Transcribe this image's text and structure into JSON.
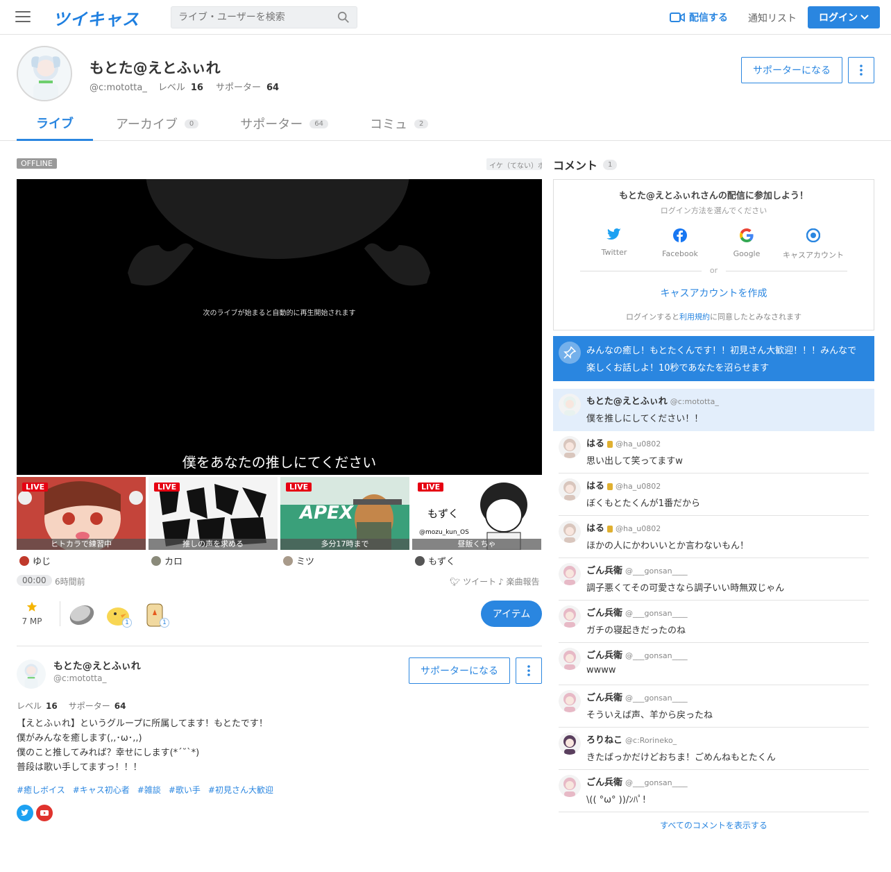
{
  "header": {
    "logo": "ツイキャス",
    "search_placeholder": "ライブ・ユーザーを検索",
    "broadcast": "配信する",
    "notify_list": "通知リスト",
    "login": "ログイン"
  },
  "profile": {
    "name": "もとた@えとふぃれ",
    "handle": "@c:mototta_",
    "level_label": "レベル",
    "level": "16",
    "supporter_label": "サポーター",
    "supporters": "64",
    "support_button": "サポーターになる"
  },
  "tabs": [
    {
      "label": "ライブ",
      "count": ""
    },
    {
      "label": "アーカイブ",
      "count": "0"
    },
    {
      "label": "サポーター",
      "count": "64"
    },
    {
      "label": "コミュ",
      "count": "2"
    }
  ],
  "live": {
    "status": "OFFLINE",
    "category": "イケ（てない）ボ",
    "autoplay_message": "次のライブが始まると自動的に再生開始されます",
    "title": "僕をあなたの推しにてください",
    "duration": "00:00",
    "time_ago": "6時間前",
    "tweet": "ツイート",
    "song_report": "楽曲報告",
    "mp": "7 MP",
    "item_button": "アイテム"
  },
  "recommendations": [
    {
      "badge": "LIVE",
      "caption": "ヒトカラで練習中",
      "user": "ゆじ",
      "thumb_color": "#c0392b"
    },
    {
      "badge": "LIVE",
      "caption": "推しの声を求める",
      "user": "カロ",
      "thumb_color": "#f4f4f4"
    },
    {
      "badge": "LIVE",
      "caption": "多分17時まで",
      "user": "ミツ",
      "thumb_color": "#2e9a6a"
    },
    {
      "badge": "LIVE",
      "caption": "昼飯くちゃ",
      "user": "もずく",
      "thumb_color": "#ffffff"
    }
  ],
  "gifts": [
    {
      "name": "coin-icon",
      "count": ""
    },
    {
      "name": "chick-icon",
      "count": "1"
    },
    {
      "name": "can-icon",
      "count": "1"
    }
  ],
  "broadcaster": {
    "name": "もとた@えとふぃれ",
    "handle": "@c:mototta_",
    "level_label": "レベル",
    "level": "16",
    "supporter_label": "サポーター",
    "supporters": "64",
    "support_button": "サポーターになる",
    "bio": [
      "【えとふぃれ】というグループに所属してます！もとたです！",
      "僕がみんなを癒します(,,･ω･,,)",
      "僕のこと推してみれば？幸せにします(*´˘`*)",
      "普段は歌い手してますっ！！！"
    ],
    "tags": [
      "#癒しボイス",
      "#キャス初心者",
      "#雑談",
      "#歌い手",
      "#初見さん大歓迎"
    ]
  },
  "comments_panel": {
    "title": "コメント",
    "count": "1",
    "login_title": "もとた@えとふぃれさんの配信に参加しよう！",
    "login_sub": "ログイン方法を選んでください",
    "providers": [
      "Twitter",
      "Facebook",
      "Google",
      "キャスアカウント"
    ],
    "or": "or",
    "create_account": "キャスアカウントを作成",
    "terms_prefix": "ログインすると",
    "terms_link": "利用規約",
    "terms_suffix": "に同意したとみなされます",
    "pinned": "みんなの癒し！もとたくんです！！初見さん大歓迎！！！みんなで楽しくお話しよ！10秒であなたを沼らせます",
    "show_all": "すべてのコメントを表示する"
  },
  "comments": [
    {
      "name": "もとた@えとふぃれ",
      "handle": "@c:mototta_",
      "text": "僕を推しにしてください！！",
      "avatar_color": "#e8f2ef",
      "highlight": true,
      "medal": false
    },
    {
      "name": "はる",
      "handle": "@ha_u0802",
      "text": "思い出して笑ってますw",
      "avatar_color": "#d9c6bd",
      "highlight": false,
      "medal": true
    },
    {
      "name": "はる",
      "handle": "@ha_u0802",
      "text": "ぼくもとたくんが1番だから",
      "avatar_color": "#d9c6bd",
      "highlight": false,
      "medal": true
    },
    {
      "name": "はる",
      "handle": "@ha_u0802",
      "text": "ほかの人にかわいいとか言わないもん！",
      "avatar_color": "#d9c6bd",
      "highlight": false,
      "medal": true
    },
    {
      "name": "ごん兵衛",
      "handle": "@___gonsan____",
      "text": "調子悪くてその可愛さなら調子いい時無双じゃん",
      "avatar_color": "#e7b9c6",
      "highlight": false,
      "medal": false
    },
    {
      "name": "ごん兵衛",
      "handle": "@___gonsan____",
      "text": "ガチの寝起きだったのね",
      "avatar_color": "#e7b9c6",
      "highlight": false,
      "medal": false
    },
    {
      "name": "ごん兵衛",
      "handle": "@___gonsan____",
      "text": "wwww",
      "avatar_color": "#e7b9c6",
      "highlight": false,
      "medal": false
    },
    {
      "name": "ごん兵衛",
      "handle": "@___gonsan____",
      "text": "そういえば声、羊から戻ったね",
      "avatar_color": "#e7b9c6",
      "highlight": false,
      "medal": false
    },
    {
      "name": "ろりねこ",
      "handle": "@c:Rorineko_",
      "text": "きたばっかだけどおちま！ごめんねもとたくん",
      "avatar_color": "#5a3f5e",
      "highlight": false,
      "medal": false
    },
    {
      "name": "ごん兵衛",
      "handle": "@___gonsan____",
      "text": "\\(( °ω° ))/ﾝﾊﾟ!",
      "avatar_color": "#e7b9c6",
      "highlight": false,
      "medal": false
    }
  ],
  "colors": {
    "accent": "#2a86e0",
    "live": "#e60012"
  }
}
